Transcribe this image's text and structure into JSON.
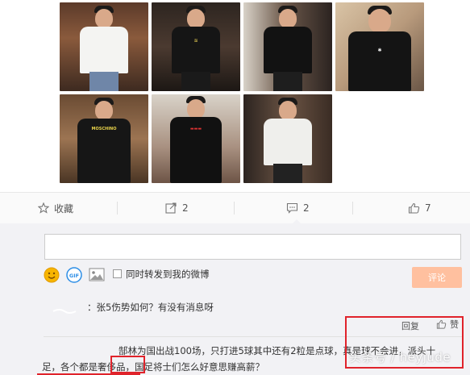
{
  "actions": {
    "favorite_label": "收藏",
    "share_count": "2",
    "comment_count": "2",
    "like_count": "7"
  },
  "composer": {
    "share_to_weibo_label": "同时转发到我的微博",
    "submit_label": "评论"
  },
  "comments": [
    {
      "text": "：张5伤势如何？有没有消息呀",
      "reply_label": "回复",
      "like_label": "赞"
    },
    {
      "line1": "郜林为国出战100场，只打进5球其中还有2粒是点球，真是球不会进，派头十",
      "line2": "足，各个都是奢侈品，国足将士们怎么好意思赚高薪？"
    }
  ],
  "watermark": "头条号 / heyjude",
  "colors": {
    "annotation_red": "#e0232b",
    "submit_bg": "#ffc09f"
  }
}
